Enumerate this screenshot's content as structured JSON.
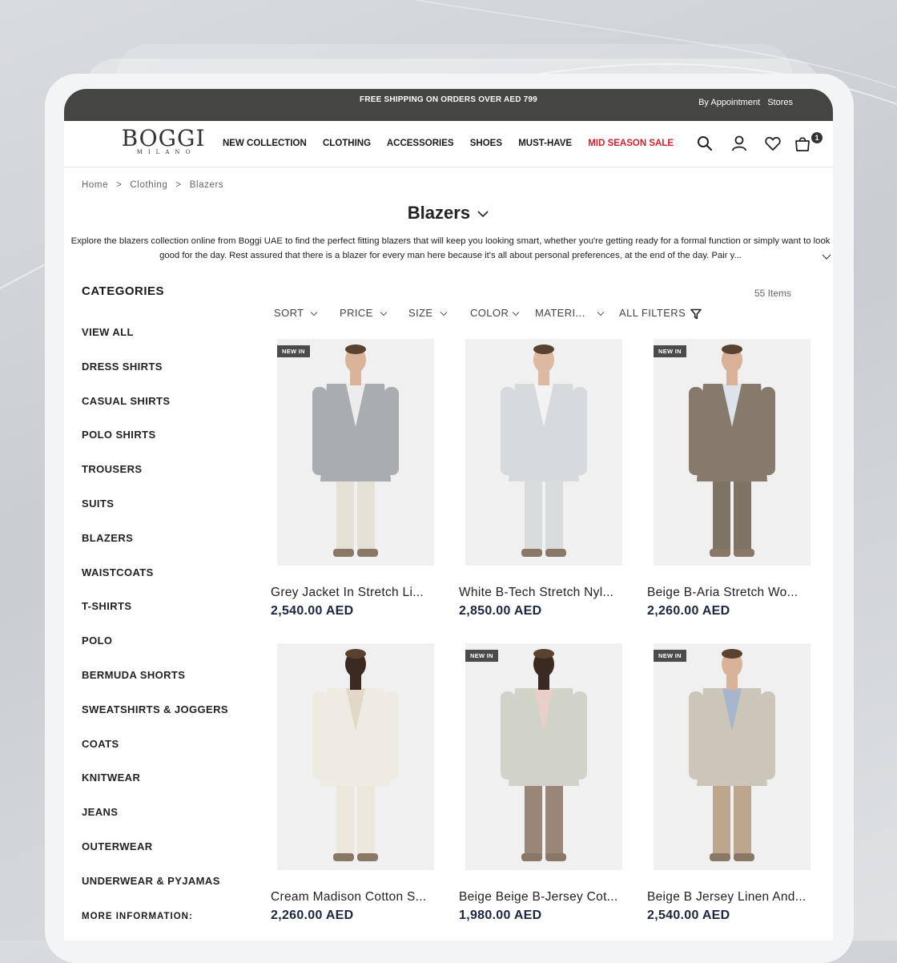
{
  "topbar": {
    "promo": "FREE SHIPPING ON ORDERS OVER AED 799",
    "appointment": "By Appointment",
    "stores": "Stores"
  },
  "logo": {
    "name": "BOGGI",
    "sub": "MILANO"
  },
  "menu": [
    {
      "label": "NEW COLLECTION"
    },
    {
      "label": "CLOTHING"
    },
    {
      "label": "ACCESSORIES"
    },
    {
      "label": "SHOES"
    },
    {
      "label": "MUST-HAVE"
    },
    {
      "label": "MID SEASON SALE",
      "color": "#d0212b"
    }
  ],
  "header_icons": [
    "search-icon",
    "account-icon",
    "wishlist-heart-icon",
    "cart-bag-icon"
  ],
  "cart_count": "1",
  "breadcrumb": [
    "Home",
    "Clothing",
    "Blazers"
  ],
  "breadcrumb_sep": ">",
  "page_title": "Blazers",
  "description": "Explore the blazers collection online from Boggi UAE to find the perfect fitting blazers that will keep you looking smart, whether you're getting ready for a formal function or simply want to look good for the day. Rest assured that there is a blazer for every man here because it's all about personal preferences, at the end of the day. Pair y...",
  "categories_title": "CATEGORIES",
  "categories": [
    "VIEW ALL",
    "DRESS SHIRTS",
    "CASUAL SHIRTS",
    "POLO SHIRTS",
    "TROUSERS",
    "SUITS",
    "BLAZERS",
    "WAISTCOATS",
    "T-SHIRTS",
    "POLO",
    "BERMUDA SHORTS",
    "SWEATSHIRTS & JOGGERS",
    "COATS",
    "KNITWEAR",
    "JEANS",
    "OUTERWEAR",
    "UNDERWEAR & PYJAMAS"
  ],
  "more_information": "MORE INFORMATION:",
  "items_count": "55 Items",
  "filters": [
    "SORT",
    "PRICE",
    "SIZE",
    "COLOR",
    "MATERI...",
    "ALL FILTERS"
  ],
  "products": [
    {
      "name": "Grey Jacket In Stretch Li...",
      "price": "2,540.00 AED",
      "tag": "NEW IN",
      "jacket": "#a9acb0",
      "trousers": "#e6e1d6",
      "shirt": "#ececec",
      "skin": "#d9b49a"
    },
    {
      "name": "White B-Tech Stretch Nyl...",
      "price": "2,850.00 AED",
      "tag": "",
      "jacket": "#d6dadc",
      "trousers": "#d9dcdd",
      "shirt": "#f3f3f3",
      "skin": "#dcb9a0"
    },
    {
      "name": "Beige B-Aria Stretch Wo...",
      "price": "2,260.00 AED",
      "tag": "NEW IN",
      "jacket": "#857a6c",
      "trousers": "#7e7466",
      "shirt": "#dde3ea",
      "skin": "#d8b196"
    },
    {
      "name": "Cream Madison Cotton S...",
      "price": "2,260.00 AED",
      "tag": "",
      "jacket": "#eeebe3",
      "trousers": "#ece7dc",
      "shirt": "#e2d8c8",
      "skin": "#3a2a22"
    },
    {
      "name": "Beige Beige B-Jersey Cot...",
      "price": "1,980.00 AED",
      "tag": "NEW IN",
      "jacket": "#d1d3c8",
      "trousers": "#9a8678",
      "shirt": "#e8cfc7",
      "skin": "#3b2a22"
    },
    {
      "name": "Beige B Jersey Linen And...",
      "price": "2,540.00 AED",
      "tag": "NEW IN",
      "jacket": "#cbc6b8",
      "trousers": "#bca78e",
      "shirt": "#a7b6cc",
      "skin": "#d9b399"
    }
  ]
}
